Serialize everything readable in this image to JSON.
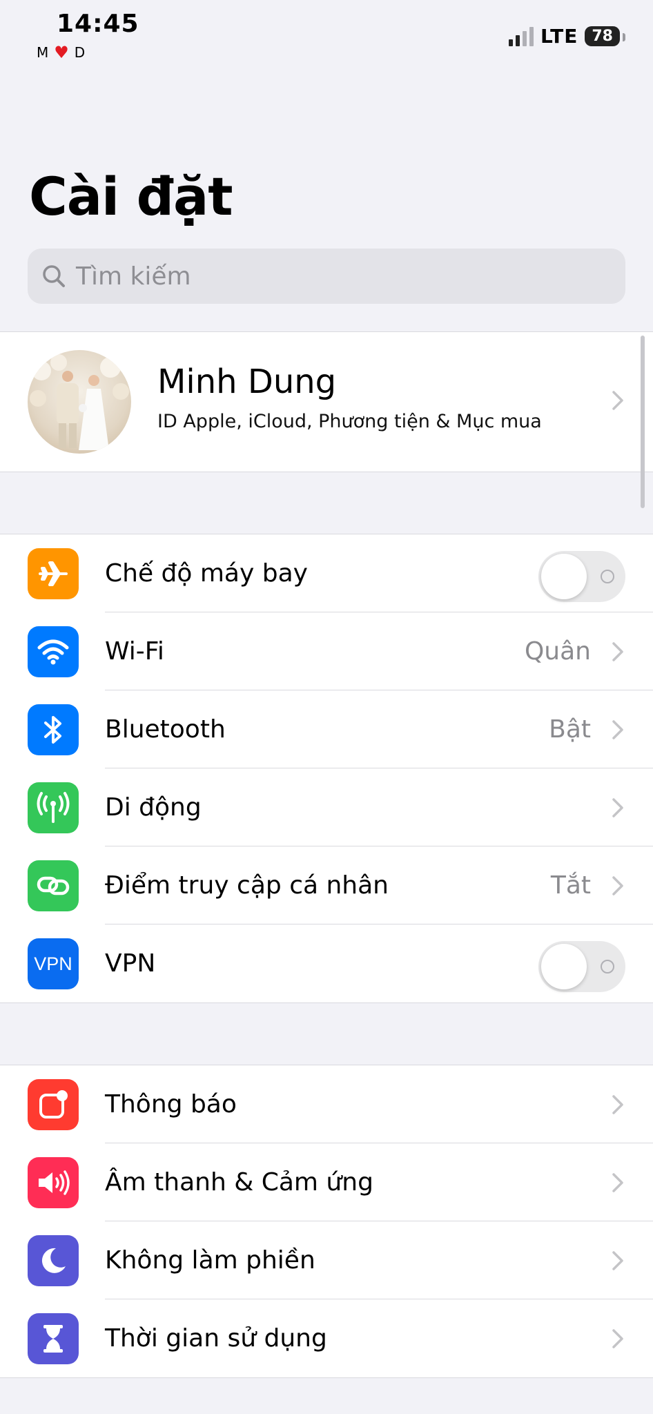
{
  "status_bar": {
    "time": "14:45",
    "carrier_left": "M",
    "carrier_right": "D",
    "network": "LTE",
    "battery": "78"
  },
  "page": {
    "title": "Cài đặt"
  },
  "search": {
    "placeholder": "Tìm kiếm"
  },
  "profile": {
    "name": "Minh Dung",
    "subtitle": "ID Apple, iCloud, Phương tiện & Mục mua"
  },
  "connectivity": [
    {
      "id": "airplane",
      "label": "Chế độ máy bay",
      "icon": "airplane-icon",
      "color": "#ff9500",
      "toggle": false
    },
    {
      "id": "wifi",
      "label": "Wi-Fi",
      "value": "Quân",
      "icon": "wifi-icon",
      "color": "#007aff"
    },
    {
      "id": "bluetooth",
      "label": "Bluetooth",
      "value": "Bật",
      "icon": "bluetooth-icon",
      "color": "#007aff"
    },
    {
      "id": "cellular",
      "label": "Di động",
      "icon": "antenna-icon",
      "color": "#34c759"
    },
    {
      "id": "hotspot",
      "label": "Điểm truy cập cá nhân",
      "value": "Tắt",
      "icon": "hotspot-icon",
      "color": "#34c759"
    },
    {
      "id": "vpn",
      "label": "VPN",
      "icon_text": "VPN",
      "icon": "vpn-icon",
      "color": "#0a6cf0",
      "toggle": false
    }
  ],
  "general": [
    {
      "id": "notifications",
      "label": "Thông báo",
      "icon": "notification-icon",
      "color": "#ff3b30"
    },
    {
      "id": "sounds",
      "label": "Âm thanh & Cảm ứng",
      "icon": "speaker-icon",
      "color": "#ff2d55"
    },
    {
      "id": "focus",
      "label": "Không làm phiền",
      "icon": "moon-icon",
      "color": "#5856d6"
    },
    {
      "id": "screentime",
      "label": "Thời gian sử dụng",
      "icon": "hourglass-icon",
      "color": "#5856d6"
    }
  ]
}
